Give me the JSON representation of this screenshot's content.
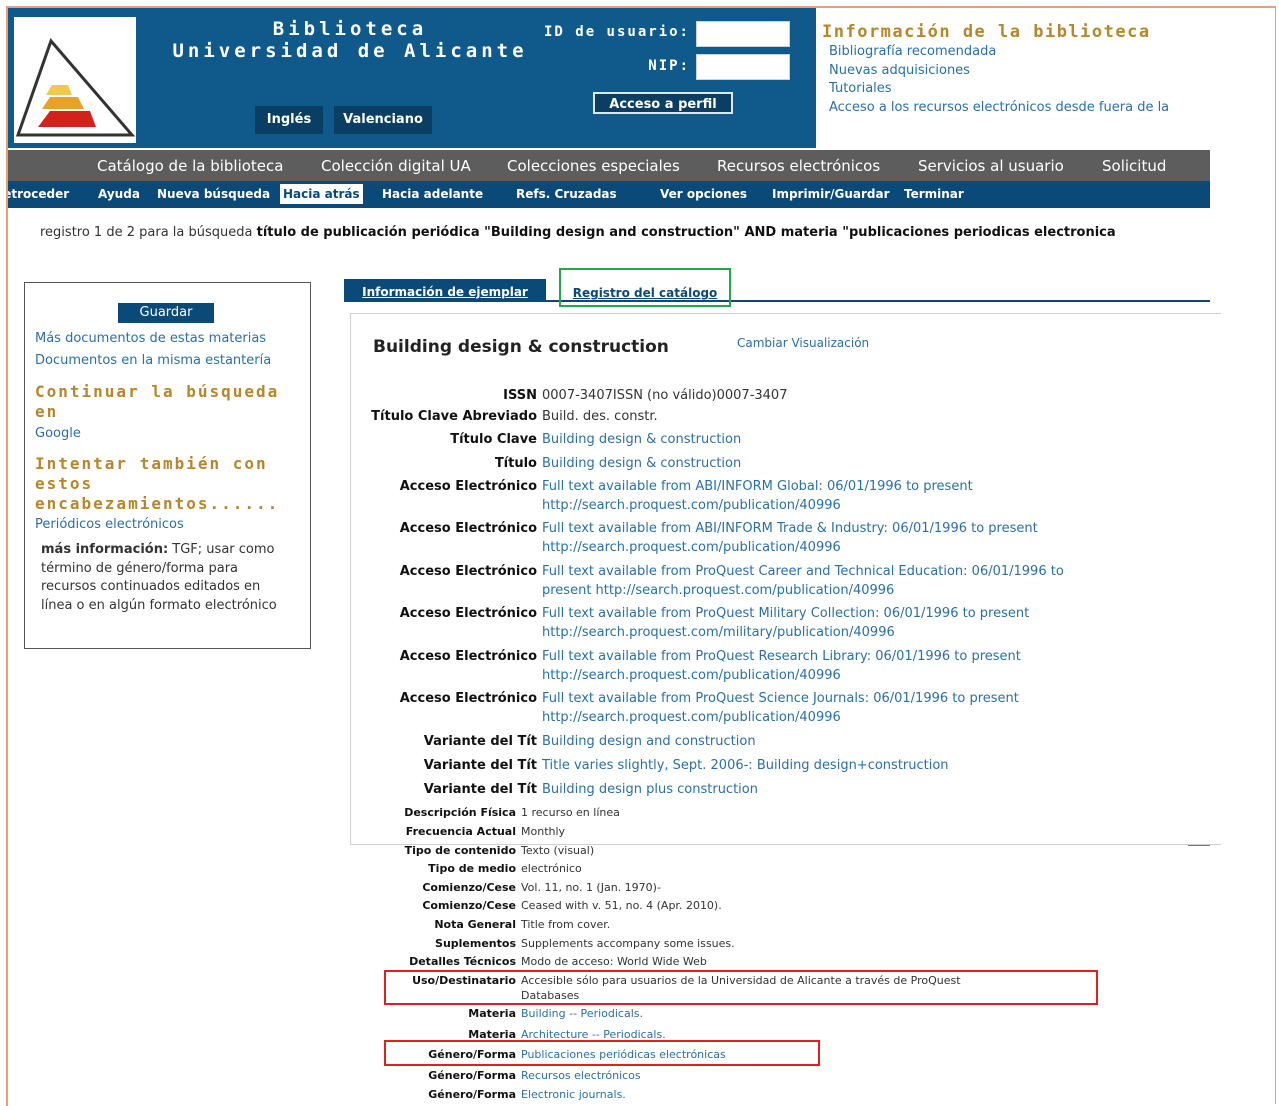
{
  "header": {
    "library_line1": "Biblioteca",
    "library_line2": "Universidad de Alicante",
    "lang_buttons": [
      "Inglés",
      "Valenciano"
    ],
    "user_id_label": "ID de usuario:",
    "pin_label": "NIP:",
    "user_id_value": "",
    "pin_value": "",
    "access_button": "Acceso a perfil"
  },
  "library_info": {
    "title": "Información de la biblioteca",
    "links": [
      "Bibliografía recomendada",
      "Nuevas adquisiciones",
      "Tutoriales",
      "Acceso a los recursos electrónicos desde fuera de la"
    ]
  },
  "nav": [
    "Catálogo de la biblioteca",
    "Colección digital UA",
    "Colecciones especiales",
    "Recursos electrónicos",
    "Servicios al usuario",
    "Solicitud"
  ],
  "toolbar": [
    "Retroceder",
    "Ayuda",
    "Nueva búsqueda",
    "Hacia atrás",
    "Hacia adelante",
    "Refs. Cruzadas",
    "Ver opciones",
    "Imprimir/Guardar",
    "Terminar"
  ],
  "search_summary": {
    "prefix": "registro 1 de 2 para la búsqueda",
    "query": "título de publicación periódica \"Building design and construction\" AND materia \"publicaciones periodicas electronica"
  },
  "sidebar": {
    "save_button": "Guardar",
    "links": [
      "Más documentos de estas materias",
      "Documentos en la misma estantería"
    ],
    "continue_heading": "Continuar la búsqueda en",
    "google_link": "Google",
    "try_heading": "Intentar también con estos encabezamientos......",
    "periodicos_link": "Periódicos electrónicos",
    "info_label": "más información:",
    "info_text": "TGF; usar como término de género/forma para recursos continuados editados en línea o en algún formato electrónico"
  },
  "tabs": [
    "Información de ejemplar",
    "Registro del catálogo"
  ],
  "record": {
    "title": "Building design & construction",
    "change_view": "Cambiar Visualización",
    "fields": [
      {
        "label": "ISSN",
        "value": "0007-3407ISSN (no válido)0007-3407"
      },
      {
        "label": "Título Clave Abreviado",
        "value": "Build. des. constr."
      },
      {
        "label": "Título Clave",
        "value": "Building design & construction"
      },
      {
        "label": "Título",
        "value": "Building design & construction"
      }
    ],
    "electronic_access": [
      {
        "label": "Acceso Electrónico",
        "line1": "Full text available from ABI/INFORM Global: 06/01/1996 to present",
        "line2": "http://search.proquest.com/publication/40996"
      },
      {
        "label": "Acceso Electrónico",
        "line1": "Full text available from ABI/INFORM Trade & Industry: 06/01/1996 to present",
        "line2": "http://search.proquest.com/publication/40996"
      },
      {
        "label": "Acceso Electrónico",
        "line1": "Full text available from ProQuest Career and Technical Education: 06/01/1996 to",
        "line2": "present http://search.proquest.com/publication/40996"
      },
      {
        "label": "Acceso Electrónico",
        "line1": "Full text available from ProQuest Military Collection: 06/01/1996 to present",
        "line2": "http://search.proquest.com/military/publication/40996"
      },
      {
        "label": "Acceso Electrónico",
        "line1": "Full text available from ProQuest Research Library: 06/01/1996 to present",
        "line2": "http://search.proquest.com/publication/40996"
      },
      {
        "label": "Acceso Electrónico",
        "line1": "Full text available from ProQuest Science Journals: 06/01/1996 to present",
        "line2": "http://search.proquest.com/publication/40996"
      }
    ],
    "variants": [
      {
        "label": "Variante del Tít",
        "value": "Building design and construction"
      },
      {
        "label": "Variante del Tít",
        "value": "Title varies slightly, Sept. 2006-: Building design+construction"
      },
      {
        "label": "Variante del Tít",
        "value": "Building design plus construction"
      }
    ],
    "details": [
      {
        "label": "Descripción Física",
        "value": "1 recurso en línea"
      },
      {
        "label": "Frecuencia Actual",
        "value": "Monthly"
      },
      {
        "label": "Tipo de contenido",
        "value": "Texto (visual)"
      },
      {
        "label": "Tipo de medio",
        "value": "electrónico"
      },
      {
        "label": "Comienzo/Cese",
        "value": "Vol. 11, no. 1 (Jan. 1970)-"
      },
      {
        "label": "Comienzo/Cese",
        "value": "Ceased with v. 51, no. 4 (Apr. 2010)."
      },
      {
        "label": "Nota General",
        "value": "Title from cover."
      },
      {
        "label": "Suplementos",
        "value": "Supplements accompany some issues."
      },
      {
        "label": "Detalles Técnicos",
        "value": "Modo de acceso: World Wide Web"
      }
    ],
    "usage": {
      "label": "Uso/Destinatario",
      "line1": "Accesible sólo para usuarios de la Universidad de Alicante a través de ProQuest",
      "line2": "Databases"
    },
    "subjects": [
      {
        "label": "Materia",
        "value": "Building -- Periodicals."
      },
      {
        "label": "Materia",
        "value": "Architecture -- Periodicals."
      }
    ],
    "genres": [
      {
        "label": "Género/Forma",
        "value": "Publicaciones periódicas electrónicas"
      },
      {
        "label": "Género/Forma",
        "value": "Recursos electrónicos"
      },
      {
        "label": "Género/Forma",
        "value": "Electronic journals."
      }
    ]
  },
  "colors": {
    "header_blue": "#0f5a8a",
    "dark_blue": "#0b4a78",
    "nav_gray": "#5d5d5d",
    "gold": "#b8862a",
    "link": "#2a6fa8",
    "highlight_red": "#e02020",
    "highlight_green": "#20a84a"
  }
}
